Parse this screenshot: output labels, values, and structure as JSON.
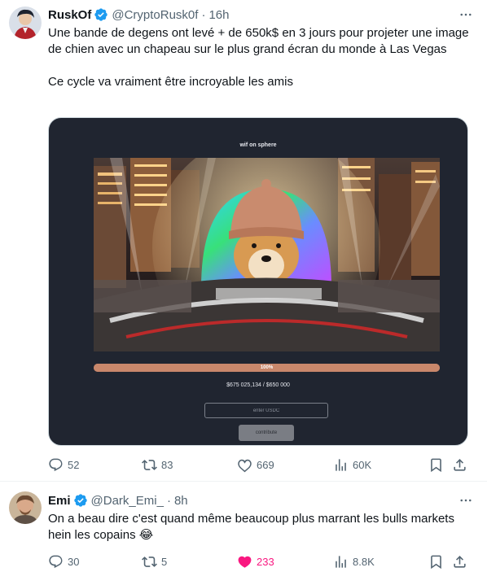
{
  "tweets": [
    {
      "author": {
        "name": "RuskOf",
        "handle": "@CryptoRusk0f",
        "time": "16h"
      },
      "text_lines": [
        "Une bande de degens ont levé + de 650k$ en 3 jours pour projeter une image de chien avec un chapeau sur le plus grand écran du monde à Las Vegas",
        "Ce cycle va vraiment être incroyable les amis"
      ],
      "media": {
        "title": "wif on sphere",
        "progress_label": "100%",
        "progress_value": 1.0,
        "raised_text": "$675 025,134 / $650 000",
        "input_placeholder": "enter USDC",
        "button_label": "contribute"
      },
      "stats": {
        "replies": "52",
        "reposts": "83",
        "likes": "669",
        "views": "60K"
      }
    },
    {
      "author": {
        "name": "Emi",
        "handle": "@Dark_Emi_",
        "time": "8h"
      },
      "text_lines": [
        "On a beau dire c'est quand même beaucoup plus marrant les bulls markets hein les copains 😂"
      ],
      "stats": {
        "replies": "30",
        "reposts": "5",
        "likes": "233",
        "views": "8.8K"
      },
      "liked": true
    }
  ],
  "colors": {
    "verified": "#1d9bf0",
    "like_active": "#f91880",
    "secondary_text": "#536471",
    "card_bg": "#202530",
    "progress": "#c8876b"
  },
  "icons": [
    "more-icon",
    "verified-icon",
    "reply-icon",
    "repost-icon",
    "like-icon",
    "views-icon",
    "bookmark-icon",
    "share-icon"
  ]
}
